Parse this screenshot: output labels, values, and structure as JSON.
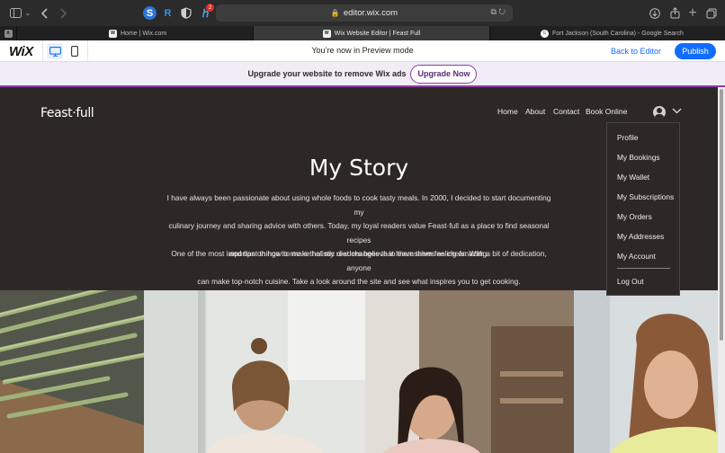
{
  "browser": {
    "url": "editor.wix.com",
    "tabs": [
      {
        "label": "Home | Wix.com",
        "favicon": "W"
      },
      {
        "label": "Wix Website Editor | Feast Full",
        "favicon": "W"
      },
      {
        "label": "Fort Jackson (South Carolina) - Google Search",
        "favicon": "G"
      }
    ],
    "tab_group_letter": "A",
    "extension_badge": "2",
    "extensions": [
      "S",
      "R"
    ]
  },
  "wix_bar": {
    "logo": "WiX",
    "preview_message": "You’re now in Preview mode",
    "back_to_editor": "Back to Editor",
    "publish": "Publish"
  },
  "upgrade": {
    "text": "Upgrade your website to remove Wix ads",
    "button": "Upgrade Now"
  },
  "site": {
    "logo": "Feast·full",
    "nav": [
      "Home",
      "About",
      "Contact",
      "Book Online"
    ],
    "title": "My Story",
    "para1": [
      "I have always been passionate about using whole foods to cook tasty meals. In 2000, I decided to start documenting my",
      "culinary journey and sharing advice with others. Today, my loyal readers value Feast·full as a place to find seasonal recipes",
      "and tips on how to make holistic diet changes that leave them feeling amazing."
    ],
    "para2": [
      "One of the most important things to me is that my readers believe in themselves as chefs. With a bit of dedication, anyone",
      "can make top-notch cuisine. Take a look around the site and see what inspires you to get cooking."
    ],
    "account_menu": [
      "Profile",
      "My Bookings",
      "My Wallet",
      "My Subscriptions",
      "My Orders",
      "My Addresses",
      "My Account"
    ],
    "logout": "Log Out"
  },
  "colors": {
    "site_background": "#2d2826",
    "accent_blue": "#116dff",
    "upgrade_purple": "#8d3fa6"
  }
}
